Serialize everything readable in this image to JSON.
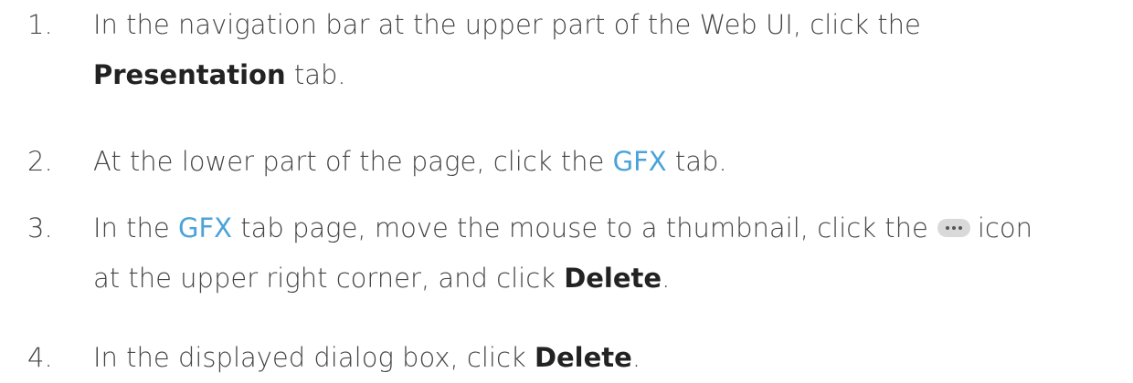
{
  "steps": [
    {
      "number": "1.",
      "line1": "In the navigation bar at the upper part of the Web UI, click the",
      "bold": "Presentation",
      "after_bold": " tab."
    },
    {
      "number": "2.",
      "before_link": "At the lower part of the page, click the ",
      "link": "GFX",
      "after_link": " tab."
    },
    {
      "number": "3.",
      "before_link": "In the ",
      "link": "GFX",
      "middle": " tab page, move the mouse to a thumbnail, click the",
      "icon": "more-options-icon",
      "after_icon": "icon",
      "line2_before": "at the upper right corner, and click ",
      "bold": "Delete",
      "line2_after": "."
    },
    {
      "number": "4.",
      "before_bold": "In the displayed dialog box, click ",
      "bold": "Delete",
      "after_bold": "."
    }
  ]
}
